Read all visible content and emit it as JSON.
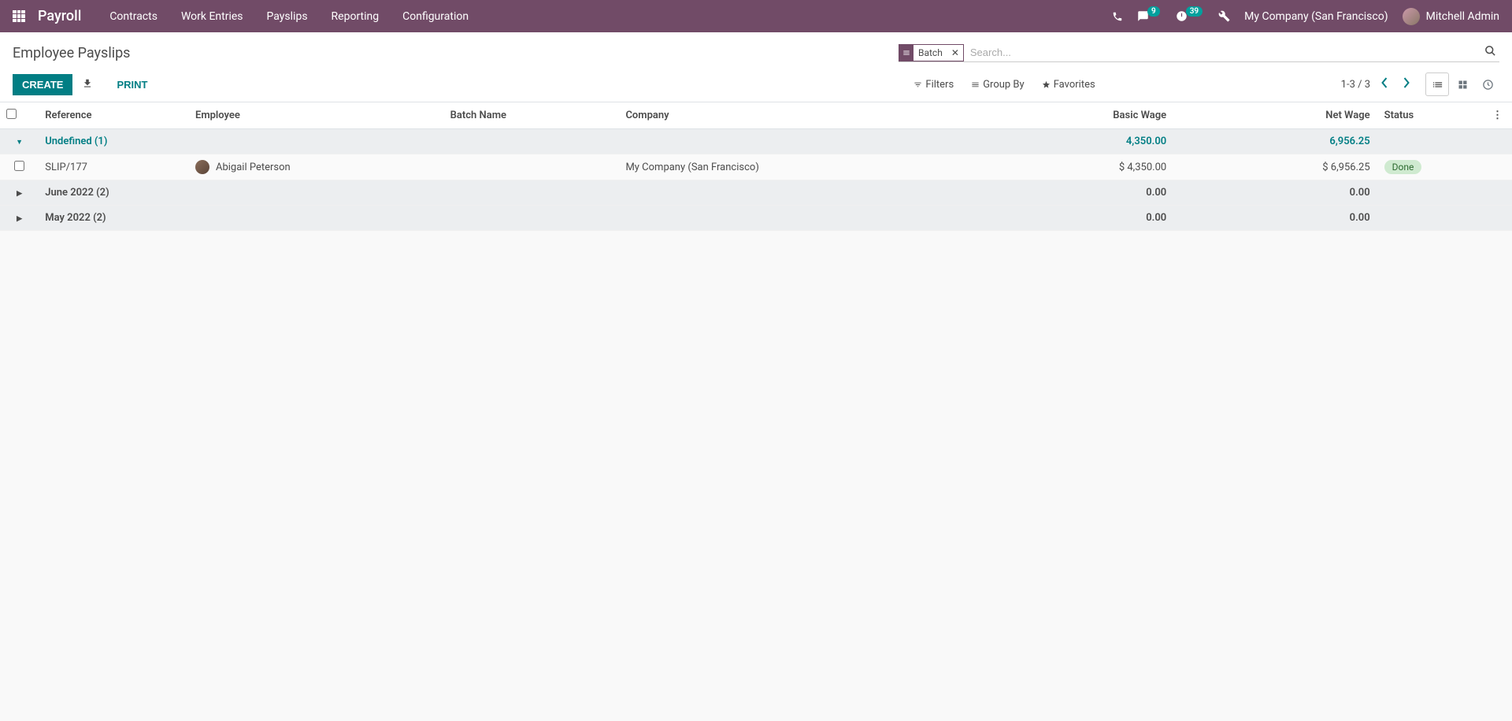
{
  "navbar": {
    "brand": "Payroll",
    "menu": [
      "Contracts",
      "Work Entries",
      "Payslips",
      "Reporting",
      "Configuration"
    ],
    "messages_badge": "9",
    "activities_badge": "39",
    "company": "My Company (San Francisco)",
    "user": "Mitchell Admin"
  },
  "breadcrumb": "Employee Payslips",
  "search": {
    "facet_label": "Batch",
    "placeholder": "Search..."
  },
  "buttons": {
    "create": "CREATE",
    "print": "PRINT"
  },
  "search_options": {
    "filters": "Filters",
    "groupby": "Group By",
    "favorites": "Favorites"
  },
  "pager": {
    "range": "1-3 / 3"
  },
  "columns": {
    "reference": "Reference",
    "employee": "Employee",
    "batch": "Batch Name",
    "company": "Company",
    "basic_wage": "Basic Wage",
    "net_wage": "Net Wage",
    "status": "Status"
  },
  "groups": [
    {
      "title": "Undefined (1)",
      "expanded": true,
      "basic_wage": "4,350.00",
      "net_wage": "6,956.25",
      "rows": [
        {
          "reference": "SLIP/177",
          "employee": "Abigail Peterson",
          "batch": "",
          "company": "My Company (San Francisco)",
          "basic_wage": "$ 4,350.00",
          "net_wage": "$ 6,956.25",
          "status": "Done"
        }
      ]
    },
    {
      "title": "June 2022 (2)",
      "expanded": false,
      "basic_wage": "0.00",
      "net_wage": "0.00",
      "rows": []
    },
    {
      "title": "May 2022 (2)",
      "expanded": false,
      "basic_wage": "0.00",
      "net_wage": "0.00",
      "rows": []
    }
  ]
}
